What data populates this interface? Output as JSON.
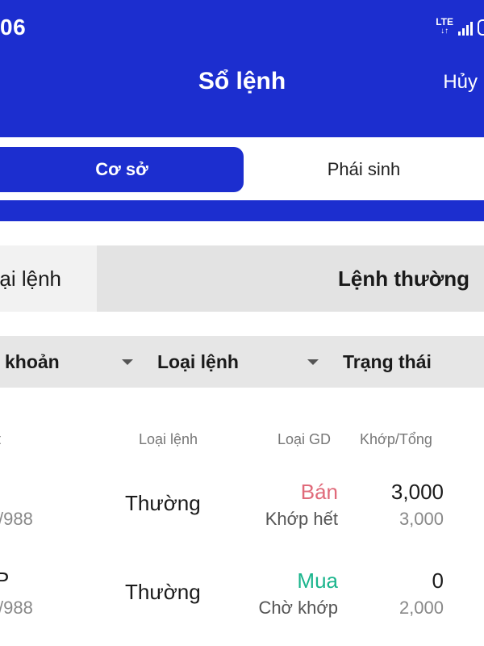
{
  "status_bar": {
    "time": "06",
    "network": "LTE"
  },
  "header": {
    "title": "Sổ lệnh",
    "cancel_label": "Hủy"
  },
  "segments": {
    "active": "Cơ sở",
    "inactive": "Phái sinh"
  },
  "order_type_selector": {
    "left_label": "ại lệnh",
    "right_label": "Lệnh thường"
  },
  "filters": {
    "account": "khoản",
    "order_type": "Loại lệnh",
    "status": "Trạng thái"
  },
  "columns": {
    "first": "t",
    "order_type": "Loại lệnh",
    "trade_type": "Loại GD",
    "matched_total": "Khớp/Tổng"
  },
  "orders": [
    {
      "left_sub": "/988",
      "order_type": "Thường",
      "trade_type": "Bán",
      "status": "Khớp hết",
      "matched": "3,000",
      "total": "3,000"
    },
    {
      "left_top": "P",
      "left_sub": "/988",
      "order_type": "Thường",
      "trade_type": "Mua",
      "status": "Chờ khớp",
      "matched": "0",
      "total": "2,000"
    }
  ],
  "colors": {
    "primary": "#1c2ecf",
    "sell": "#e06a7a",
    "buy": "#1bb58d"
  }
}
